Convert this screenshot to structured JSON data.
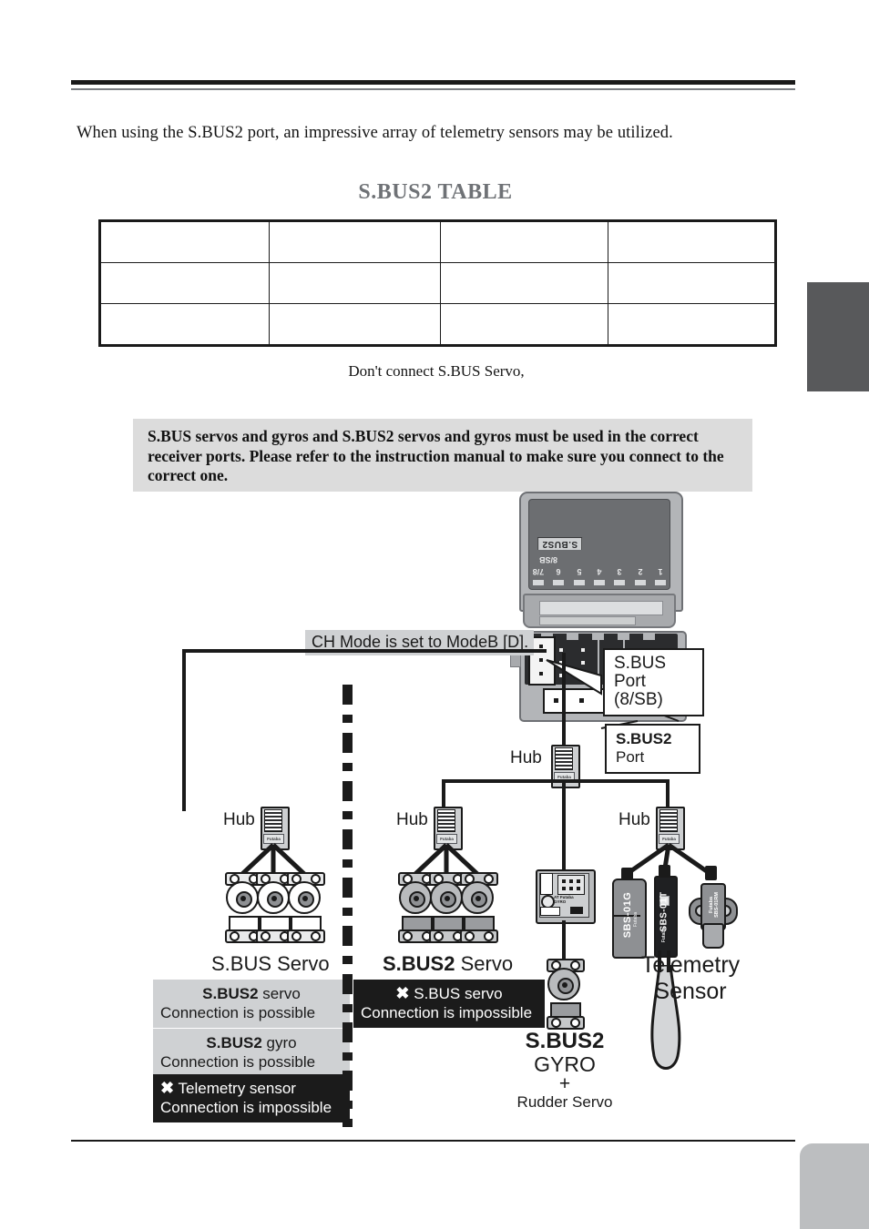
{
  "page": {
    "intro": "When using the S.BUS2 port, an impressive array of telemetry sensors may be utilized.",
    "table_title": "S.BUS2 TABLE",
    "table_caption": "Don't connect S.BUS Servo,",
    "warning": "S.BUS servos and gyros and S.BUS2 servos and gyros must be used in the correct receiver ports. Please refer to the instruction manual to make sure you connect to the correct one."
  },
  "table": {
    "columns": [
      "",
      "",
      "",
      ""
    ],
    "rows": [
      [
        "",
        "",
        "",
        ""
      ],
      [
        "",
        "",
        "",
        ""
      ],
      [
        "",
        "",
        "",
        ""
      ]
    ]
  },
  "receiver": {
    "sbus2_text": "S.BUS2",
    "sb_text": "8/SB",
    "channels": [
      "1",
      "2",
      "3",
      "4",
      "5",
      "6",
      "7/8"
    ]
  },
  "diagram": {
    "ch_mode_label": "CH Mode is set to ModeB [D].",
    "callout_sbus_port": [
      "S.BUS",
      "Port",
      "(8/SB)"
    ],
    "callout_sbus2_port": {
      "bold": "S.BUS2",
      "normal": "Port"
    },
    "hub_label": "Hub",
    "hub_brand": "Futaba",
    "groups": {
      "left": {
        "bold": "",
        "normal": "S.BUS Servo"
      },
      "middle": {
        "bold": "S.BUS2",
        "normal": " Servo"
      },
      "right": {
        "line1": "Telemetry",
        "line2": "Sensor"
      }
    },
    "gyro_label": {
      "line1": "S.BUS2",
      "line2": "GYRO",
      "line3": "+",
      "line4": "Rudder Servo"
    },
    "gyro_module_text": [
      "AT Futaba",
      "GYRO"
    ],
    "sensors": [
      {
        "name": "SBS-01G",
        "brand": "Futaba"
      },
      {
        "name": "SBS-01T",
        "brand": "Futaba"
      },
      {
        "name": "Futaba",
        "sub": "SBS-01RM"
      }
    ],
    "chips": [
      {
        "style": "gray",
        "x": "",
        "bold": "S.BUS2",
        "rest": " servo",
        "line2": "Connection is possible"
      },
      {
        "style": "gray",
        "x": "",
        "bold": "S.BUS2",
        "rest": " gyro",
        "line2": "Connection is possible"
      },
      {
        "style": "black",
        "x": "✖",
        "bold": "",
        "rest": "Telemetry sensor",
        "line2": "Connection is impossible"
      },
      {
        "style": "black",
        "x": "✖",
        "bold": "",
        "rest": "S.BUS servo",
        "line2": "Connection is impossible"
      }
    ]
  },
  "colors": {
    "rule_dark": "#1a1a1a",
    "rule_gray": "#7a7d82",
    "title_gray": "#6f7276",
    "band_gray": "#dcdcdc",
    "chip_gray": "#cfd1d3",
    "chip_black": "#1b1b1b",
    "tab_dark": "#58595b",
    "tab_light": "#bcbec0"
  }
}
